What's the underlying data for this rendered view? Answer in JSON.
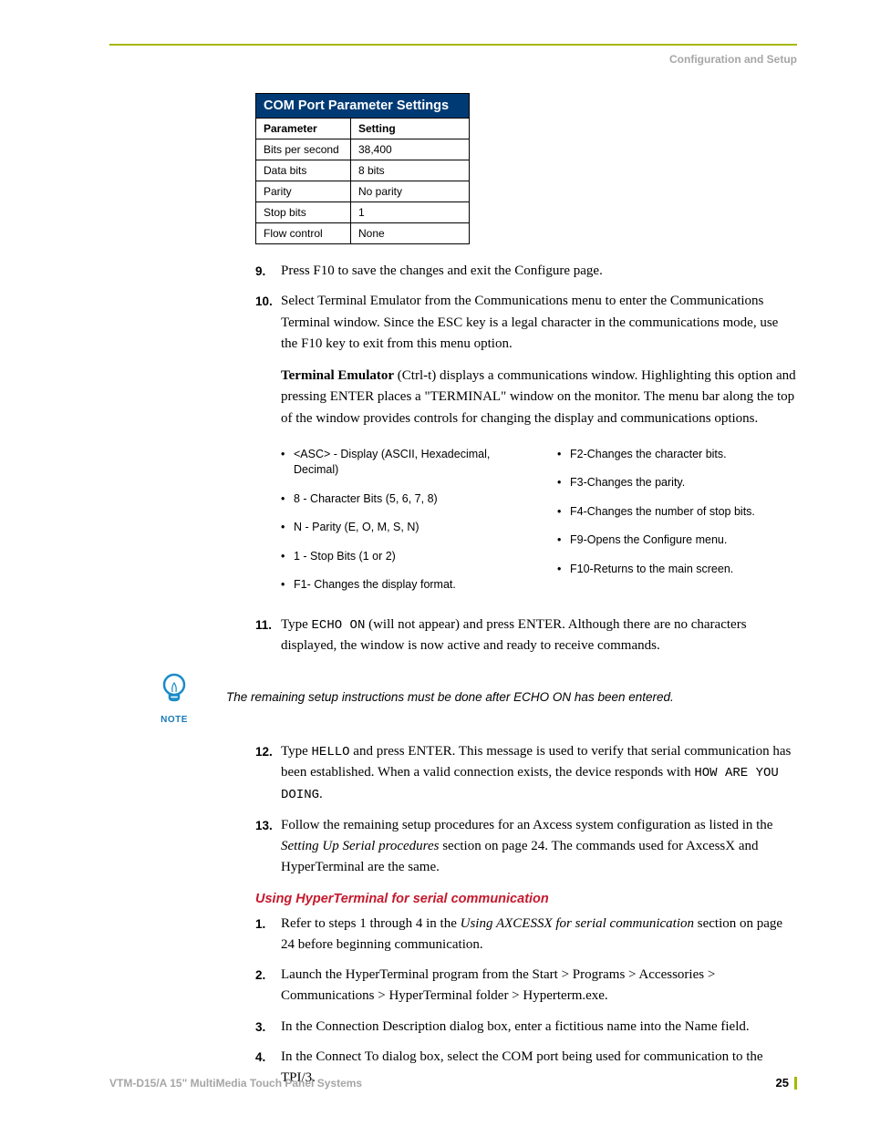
{
  "header": {
    "section": "Configuration and Setup"
  },
  "table": {
    "title": "COM Port Parameter Settings",
    "head": {
      "col1": "Parameter",
      "col2": "Setting"
    },
    "rows": [
      {
        "p": "Bits per second",
        "s": "38,400"
      },
      {
        "p": "Data bits",
        "s": "8 bits"
      },
      {
        "p": "Parity",
        "s": "No parity"
      },
      {
        "p": "Stop bits",
        "s": "1"
      },
      {
        "p": "Flow control",
        "s": "None"
      }
    ]
  },
  "steps9_11": {
    "s9": "Press F10 to save the changes and exit the Configure page.",
    "s10": "Select Terminal Emulator from the Communications menu to enter the Communications Terminal window. Since the ESC key is a legal character in the communications mode, use the F10 key to exit from this menu option.",
    "term_bold": "Terminal Emulator",
    "term_rest": " (Ctrl-t) displays a communications window. Highlighting this option and pressing ENTER places a \"TERMINAL\" window on the monitor. The menu bar along the top of the window provides controls for changing the display and communications options.",
    "left": [
      "<ASC> - Display (ASCII, Hexadecimal, Decimal)",
      "8 - Character Bits (5, 6, 7, 8)",
      "N - Parity (E, O, M, S, N)",
      "1 - Stop Bits (1 or 2)",
      "F1- Changes the display format."
    ],
    "right": [
      "F2-Changes the character bits.",
      "F3-Changes the parity.",
      "F4-Changes the number of stop bits.",
      "F9-Opens the Configure menu.",
      "F10-Returns to the main screen."
    ],
    "s11_a": "Type ",
    "s11_cmd": "ECHO ON",
    "s11_b": " (will not appear) and press ENTER. Although there are no characters displayed, the window is now active and ready to receive commands."
  },
  "note": {
    "label": "NOTE",
    "text": "The remaining setup instructions must be done after ECHO ON has been entered."
  },
  "steps12_13": {
    "s12_a": "Type ",
    "s12_cmd1": "HELLO",
    "s12_b": " and press ENTER. This message is used to verify that serial communication has been established. When a valid connection exists, the device responds with ",
    "s12_cmd2": "HOW ARE YOU DOING",
    "s12_c": ".",
    "s13_a": "Follow the remaining setup procedures for an Axcess system configuration as listed in the ",
    "s13_i": "Setting Up Serial procedures",
    "s13_b": " section on page 24. The commands used for AxcessX and HyperTerminal are the same."
  },
  "hyper": {
    "heading": "Using HyperTerminal for serial communication",
    "h1_a": "Refer to steps 1 through 4 in the ",
    "h1_i": "Using AXCESSX for serial communication",
    "h1_b": " section on page 24 before beginning communication.",
    "h2": "Launch the HyperTerminal program from the Start > Programs > Accessories > Communications > HyperTerminal folder > Hyperterm.exe.",
    "h3": "In the Connection Description dialog box, enter a fictitious name into the Name field.",
    "h4": "In the Connect To dialog box, select the COM port being used for communication to the TPI/3."
  },
  "footer": {
    "title": "VTM-D15/A 15\" MultiMedia Touch Panel Systems",
    "page": "25"
  }
}
